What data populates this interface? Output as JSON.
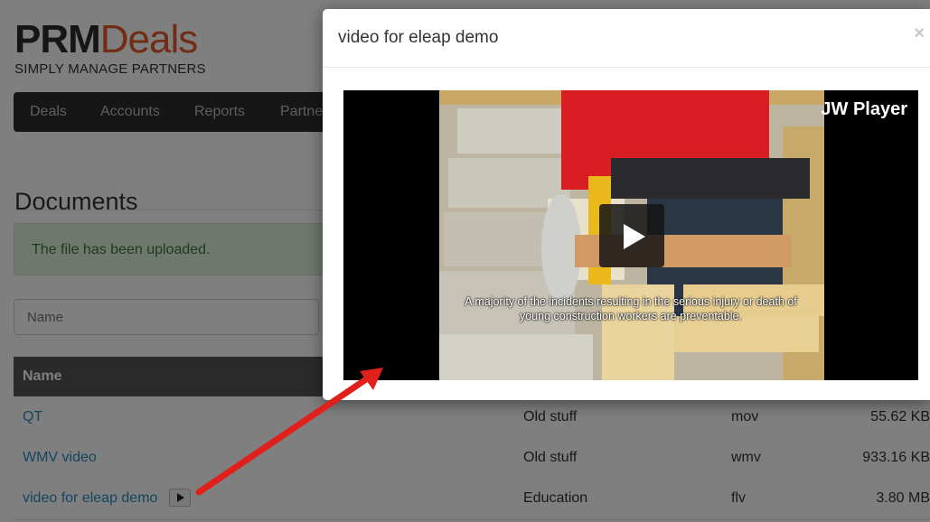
{
  "brand": {
    "name_part1": "PRM",
    "name_part2": "Deals",
    "tagline": "SIMPLY MANAGE PARTNERS"
  },
  "nav": {
    "items": [
      "Deals",
      "Accounts",
      "Reports",
      "Partne"
    ]
  },
  "page": {
    "title": "Documents"
  },
  "alert": {
    "text": "The file has been uploaded."
  },
  "search": {
    "placeholder": "Name"
  },
  "table": {
    "header_name": "Name",
    "rows": [
      {
        "name": "QT",
        "category": "Old stuff",
        "type": "mov",
        "size": "55.62 KB"
      },
      {
        "name": "WMV video",
        "category": "Old stuff",
        "type": "wmv",
        "size": "933.16 KB"
      },
      {
        "name": "video for eleap demo",
        "category": "Education",
        "type": "flv",
        "size": "3.80 MB"
      }
    ]
  },
  "modal": {
    "title": "video for eleap demo",
    "close_glyph": "×",
    "player_label": "JW Player",
    "caption": "A majority of the incidents resulting in the serious injury or death of young construction workers are preventable."
  },
  "colors": {
    "brand_accent": "#e2592b",
    "link": "#2a8bbf",
    "arrow": "#e0201b"
  },
  "icons": {
    "play": "play-icon",
    "close": "close-icon",
    "arrow": "annotation-arrow"
  }
}
